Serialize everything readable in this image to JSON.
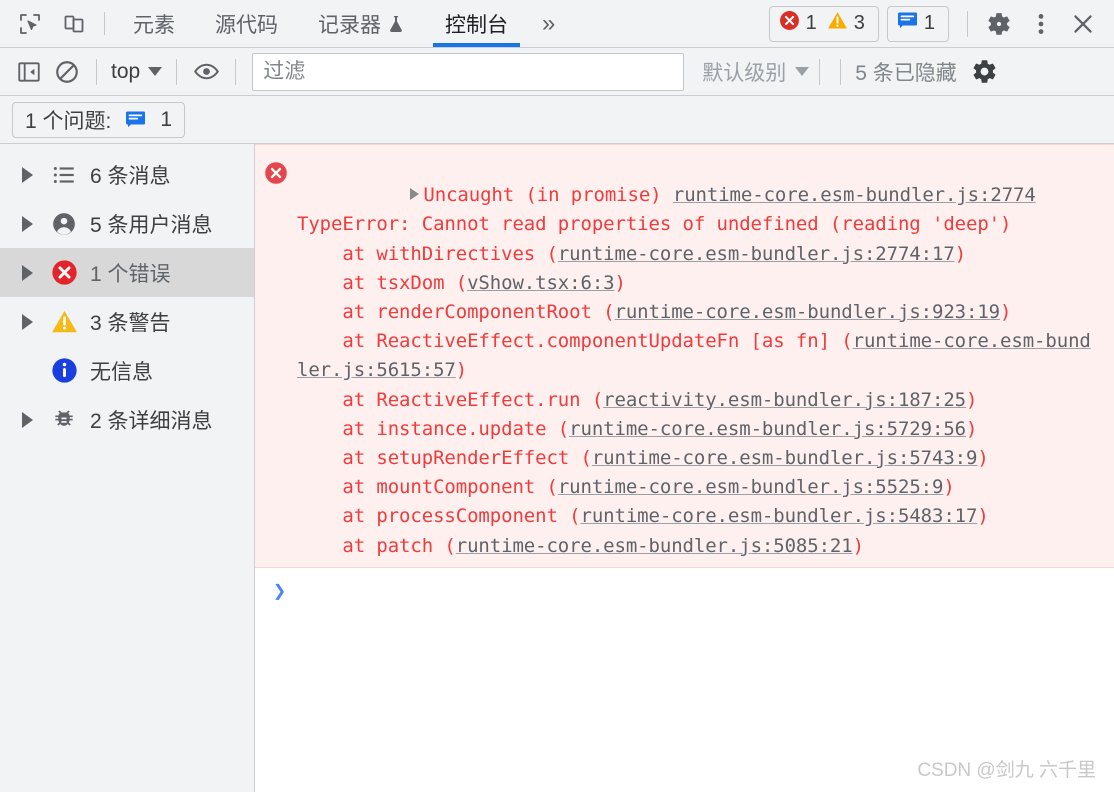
{
  "tabbar": {
    "inspect_icon": "cursor-select-icon",
    "device_icon": "device-toolbar-icon",
    "tabs": [
      {
        "label": "元素",
        "active": false,
        "flask": false
      },
      {
        "label": "源代码",
        "active": false,
        "flask": false
      },
      {
        "label": "记录器",
        "active": false,
        "flask": true
      },
      {
        "label": "控制台",
        "active": true,
        "flask": false
      }
    ],
    "more_tabs": "»",
    "error_count": "1",
    "warning_count": "3",
    "info_count": "1",
    "settings_icon": "gear-icon",
    "menu_icon": "kebab-menu-icon",
    "close_icon": "close-icon",
    "accent_color": "#1a73e8",
    "error_color": "#d93025",
    "warning_color": "#f9ab00",
    "info_color": "#1a73e8"
  },
  "filterbar": {
    "sidebar_toggle_icon": "show-console-sidebar-icon",
    "clear_icon": "clear-console-icon",
    "context": "top",
    "eye_icon": "live-expression-icon",
    "filter_placeholder": "过滤",
    "filter_value": "",
    "level": "默认级别",
    "hidden_text": "5 条已隐藏",
    "settings_icon": "gear-icon"
  },
  "issuesbar": {
    "label": "1 个问题:",
    "count": "1",
    "icon": "issues-icon"
  },
  "sidebar": {
    "items": [
      {
        "label": "6 条消息",
        "icon": "list-icon",
        "arrow": true,
        "selected": false
      },
      {
        "label": "5 条用户消息",
        "icon": "person-icon",
        "arrow": true,
        "selected": false
      },
      {
        "label": "1 个错误",
        "icon": "error-icon",
        "arrow": true,
        "selected": true
      },
      {
        "label": "3 条警告",
        "icon": "warning-icon",
        "arrow": true,
        "selected": false
      },
      {
        "label": "无信息",
        "icon": "info-icon",
        "arrow": false,
        "selected": false
      },
      {
        "label": "2 条详细消息",
        "icon": "bug-icon",
        "arrow": true,
        "selected": false
      }
    ]
  },
  "console": {
    "error": {
      "icon": "error-icon",
      "header_text": "Uncaught (in promise) ",
      "header_link": "runtime-core.esm-bundler.js:2774",
      "message": "TypeError: Cannot read properties of undefined (reading 'deep')",
      "stack": [
        {
          "fn": "    at withDirectives (",
          "link": "runtime-core.esm-bundler.js:2774:17",
          "tail": ")"
        },
        {
          "fn": "    at tsxDom (",
          "link": "vShow.tsx:6:3",
          "tail": ")"
        },
        {
          "fn": "    at renderComponentRoot (",
          "link": "runtime-core.esm-bundler.js:923:19",
          "tail": ")"
        },
        {
          "fn": "    at ReactiveEffect.componentUpdateFn [as fn] (",
          "link": "runtime-core.esm-bundler.js:5615:57",
          "tail": ")"
        },
        {
          "fn": "    at ReactiveEffect.run (",
          "link": "reactivity.esm-bundler.js:187:25",
          "tail": ")"
        },
        {
          "fn": "    at instance.update (",
          "link": "runtime-core.esm-bundler.js:5729:56",
          "tail": ")"
        },
        {
          "fn": "    at setupRenderEffect (",
          "link": "runtime-core.esm-bundler.js:5743:9",
          "tail": ")"
        },
        {
          "fn": "    at mountComponent (",
          "link": "runtime-core.esm-bundler.js:5525:9",
          "tail": ")"
        },
        {
          "fn": "    at processComponent (",
          "link": "runtime-core.esm-bundler.js:5483:17",
          "tail": ")"
        },
        {
          "fn": "    at patch (",
          "link": "runtime-core.esm-bundler.js:5085:21",
          "tail": ")"
        }
      ],
      "background_color": "#fff0f0",
      "text_color": "#ef3b3b"
    },
    "prompt_symbol": "❯",
    "watermark": "CSDN @剑九 六千里"
  }
}
